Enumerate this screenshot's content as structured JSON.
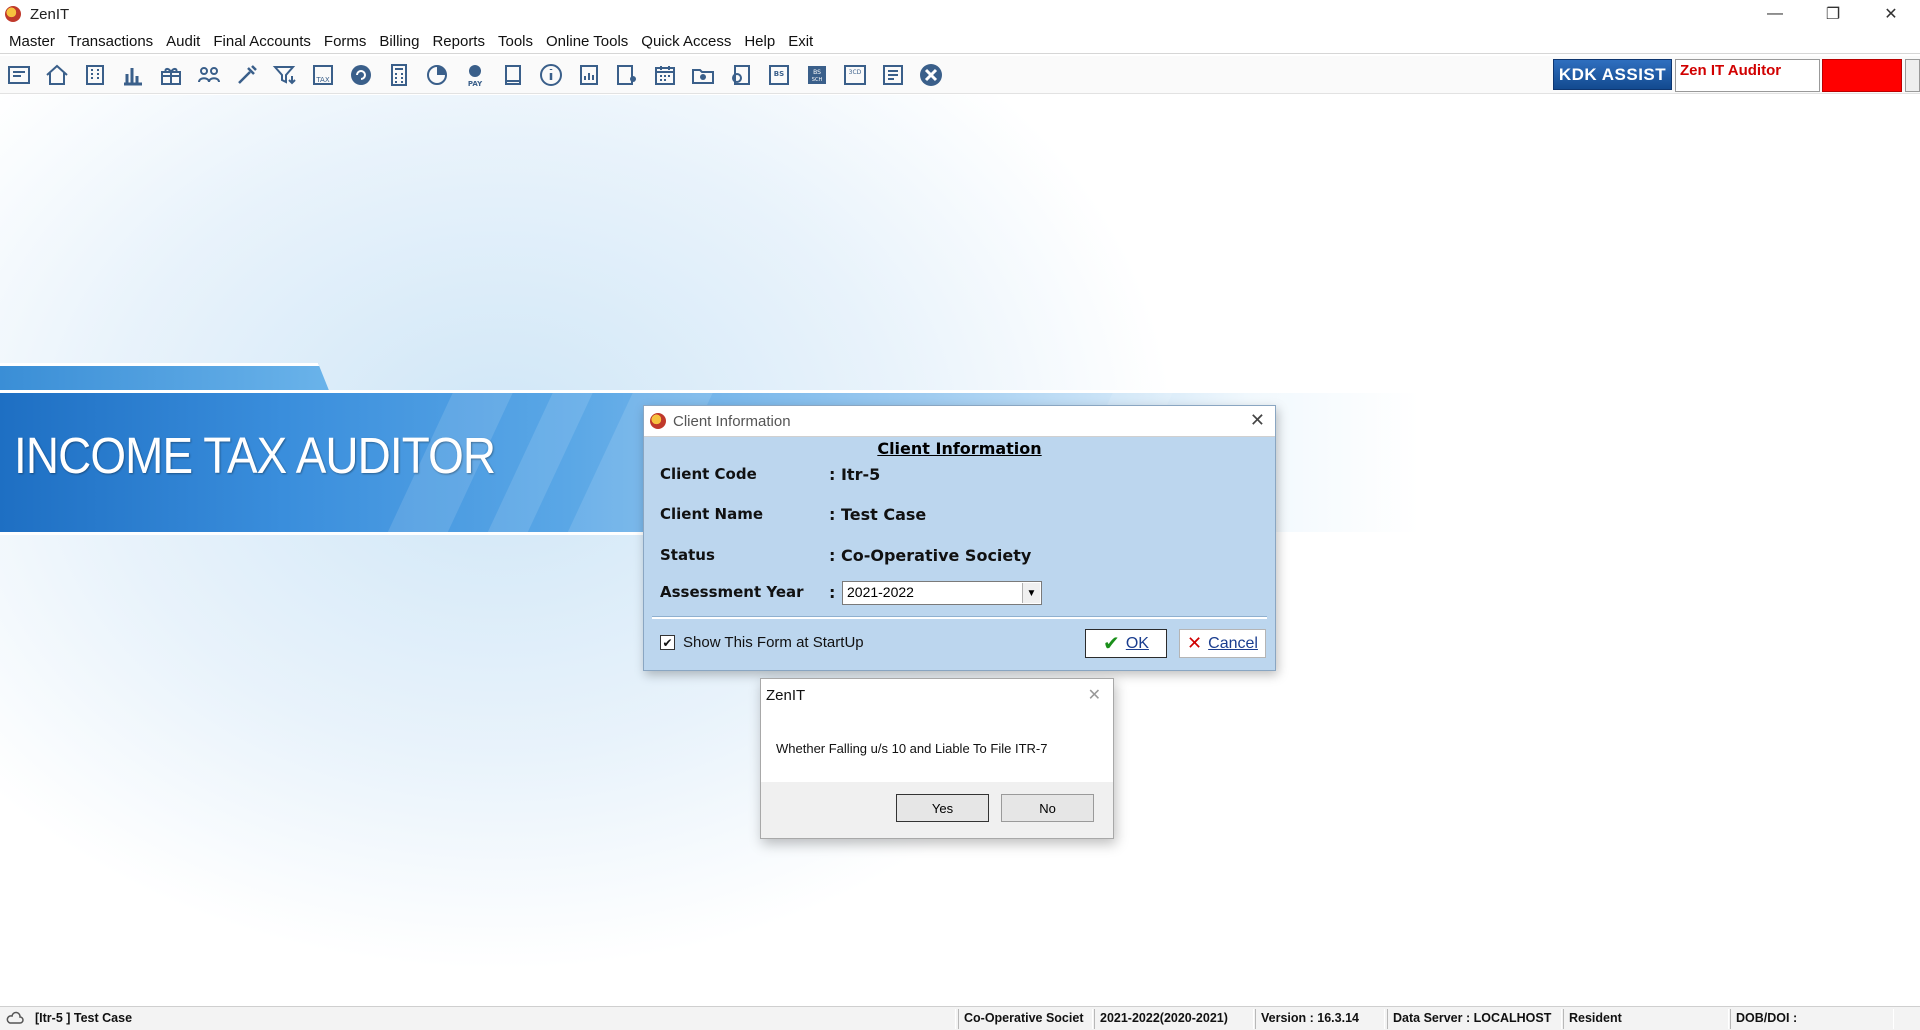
{
  "window": {
    "title": "ZenIT",
    "controls": [
      "—",
      "❐",
      "✕"
    ]
  },
  "menu": [
    "Master",
    "Transactions",
    "Audit",
    "Final Accounts",
    "Forms",
    "Billing",
    "Reports",
    "Tools",
    "Online Tools",
    "Quick Access",
    "Help",
    "Exit"
  ],
  "toolbar": {
    "icons": [
      "company-icon",
      "home-icon",
      "building-icon",
      "bar-chart-icon",
      "gift-icon",
      "users-icon",
      "tools-icon",
      "filter-icon",
      "tax-icon",
      "refresh-icon",
      "calculator-icon",
      "pie-chart-icon",
      "pay-icon",
      "book-icon",
      "info-icon",
      "report-icon",
      "document-user-icon",
      "calendar-icon",
      "folder-icon",
      "document-search-icon",
      "bs-icon",
      "bs-sch-icon",
      "3cd-icon",
      "form-icon",
      "close-circle-icon"
    ],
    "kdk_label": "KDK ASSIST",
    "product_label": "Zen IT Auditor"
  },
  "banner": {
    "title": "INCOME TAX AUDITOR"
  },
  "client_dialog": {
    "caption": "Client Information",
    "heading": "Client Information",
    "fields": {
      "code_label": "Client Code",
      "code_value": ": Itr-5",
      "name_label": "Client Name",
      "name_value": ": Test Case",
      "status_label": "Status",
      "status_value": ": Co-Operative Society",
      "ay_label": "Assessment Year",
      "ay_colon": ":",
      "ay_value": "2021-2022"
    },
    "startup_checkbox": {
      "label": "Show This Form at StartUp",
      "checked": true
    },
    "ok_label": "OK",
    "cancel_label": "Cancel"
  },
  "message_box": {
    "title": "ZenIT",
    "text": "Whether Falling u/s 10 and Liable To File ITR-7",
    "yes_label": "Yes",
    "no_label": "No"
  },
  "status_bar": {
    "client": "[Itr-5 ] Test Case",
    "status": "Co-Operative Societ",
    "year": "2021-2022(2020-2021)",
    "version": "Version : 16.3.14",
    "server": "Data Server : LOCALHOST",
    "residence": "Resident",
    "dob": "DOB/DOI :"
  }
}
